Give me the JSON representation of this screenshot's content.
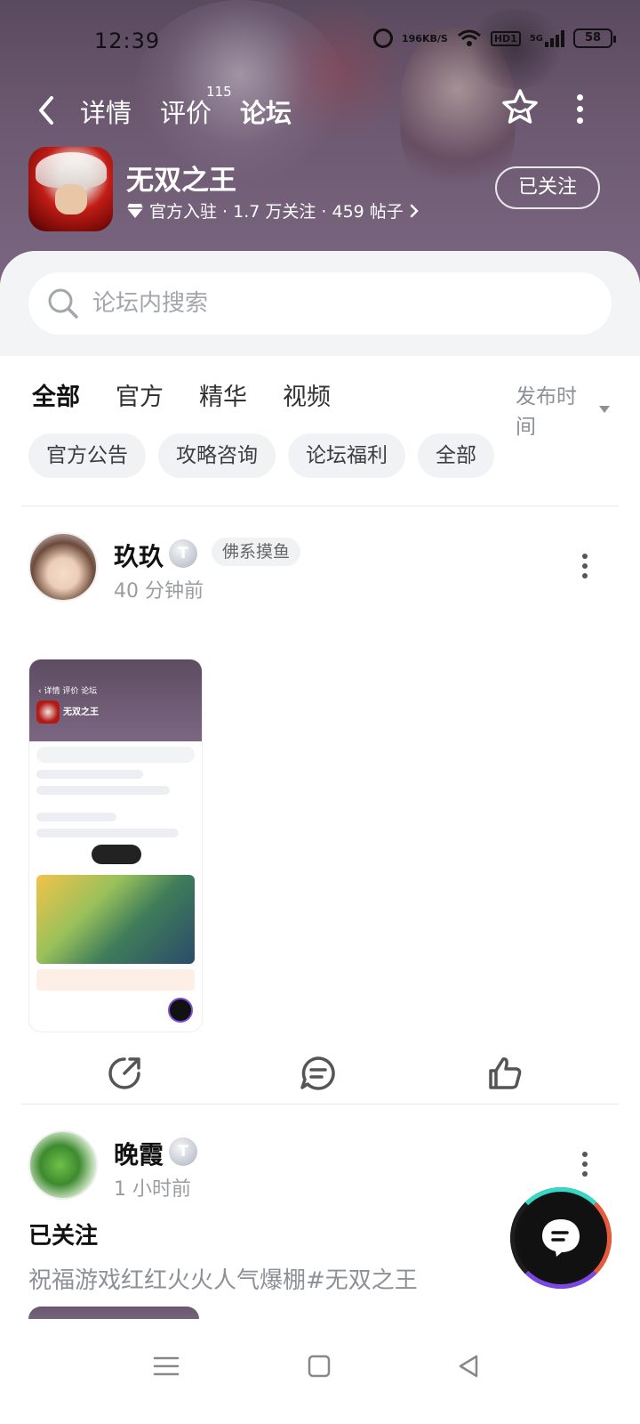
{
  "status_bar": {
    "time": "12:39",
    "net_speed_value": "196",
    "net_speed_unit": "KB/S",
    "hd_label": "HD1",
    "signal_label": "5G",
    "battery": "58"
  },
  "nav": {
    "tabs": [
      {
        "label": "详情"
      },
      {
        "label": "评价",
        "badge": "115"
      },
      {
        "label": "论坛",
        "active": true
      }
    ],
    "back_icon": "chevron-left-icon",
    "star_icon": "star-icon",
    "more_icon": "more-vertical-icon"
  },
  "game": {
    "name": "无双之王",
    "meta": "官方入驻 · 1.7 万关注 · 459 帖子",
    "follow_label": "已关注"
  },
  "search": {
    "placeholder": "论坛内搜索"
  },
  "category_tabs": {
    "tabs": [
      {
        "label": "全部",
        "active": true
      },
      {
        "label": "官方"
      },
      {
        "label": "精华"
      },
      {
        "label": "视频"
      }
    ],
    "sort_label": "发布时间"
  },
  "chips": [
    "官方公告",
    "攻略咨询",
    "论坛福利",
    "全部"
  ],
  "posts": [
    {
      "user": "玖玖",
      "level": "T",
      "tag": "佛系摸鱼",
      "time": "40 分钟前"
    },
    {
      "user": "晚霞",
      "level": "T",
      "time": "1 小时前",
      "title": "已关注",
      "body": "祝福游戏红红火火人气爆棚#无双之王"
    }
  ],
  "accent_color": "#2fd7c4"
}
